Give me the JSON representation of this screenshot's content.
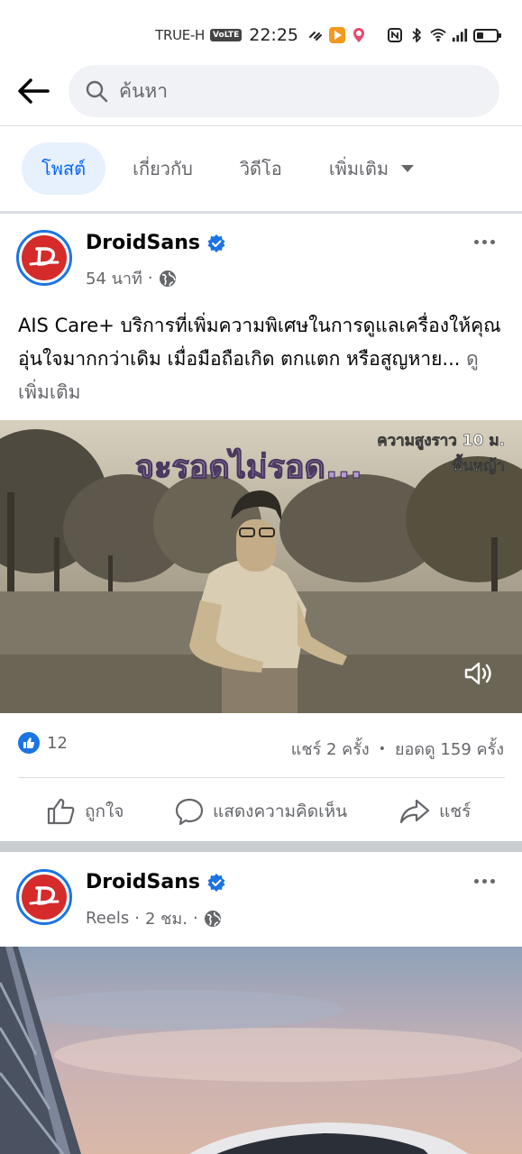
{
  "status_bar": {
    "carrier": "TRUE-H",
    "volte": "VoLTE",
    "time": "22:25"
  },
  "search": {
    "placeholder": "ค้นหา",
    "icon": "search-icon",
    "back_icon": "back-arrow-icon"
  },
  "tabs": [
    {
      "label": "โพสต์",
      "active": true
    },
    {
      "label": "เกี่ยวกับ",
      "active": false
    },
    {
      "label": "วิดีโอ",
      "active": false
    },
    {
      "label": "เพิ่มเติม",
      "active": false
    }
  ],
  "post1": {
    "page_name": "DroidSans",
    "time": "54 นาที",
    "text": "AIS Care+ บริการที่เพิ่มความพิเศษในการดูแลเครื่องให้คุณอุ่นใจมากกว่าเดิม เมื่อมือถือเกิด ตกแตก หรือสูญหาย...",
    "see_more": "ดูเพิ่มเติม",
    "video": {
      "headline": "จะรอดไม่รอด...",
      "caption_line1": "ความสูงราว 10 ม.",
      "caption_line2": "พื้นหญ้า"
    },
    "reaction_count": "12",
    "shares": "แชร์ 2 ครั้ง",
    "separator": "•",
    "views": "ยอดดู 159 ครั้ง",
    "actions": {
      "like": "ถูกใจ",
      "comment": "แสดงความคิดเห็น",
      "share": "แชร์"
    }
  },
  "post2": {
    "page_name": "DroidSans",
    "type": "Reels",
    "time": "2 ชม."
  },
  "colors": {
    "accent": "#0866ff",
    "verified": "#1b74e4",
    "logo_red": "#d52b2b",
    "muted_text": "#65676b"
  }
}
